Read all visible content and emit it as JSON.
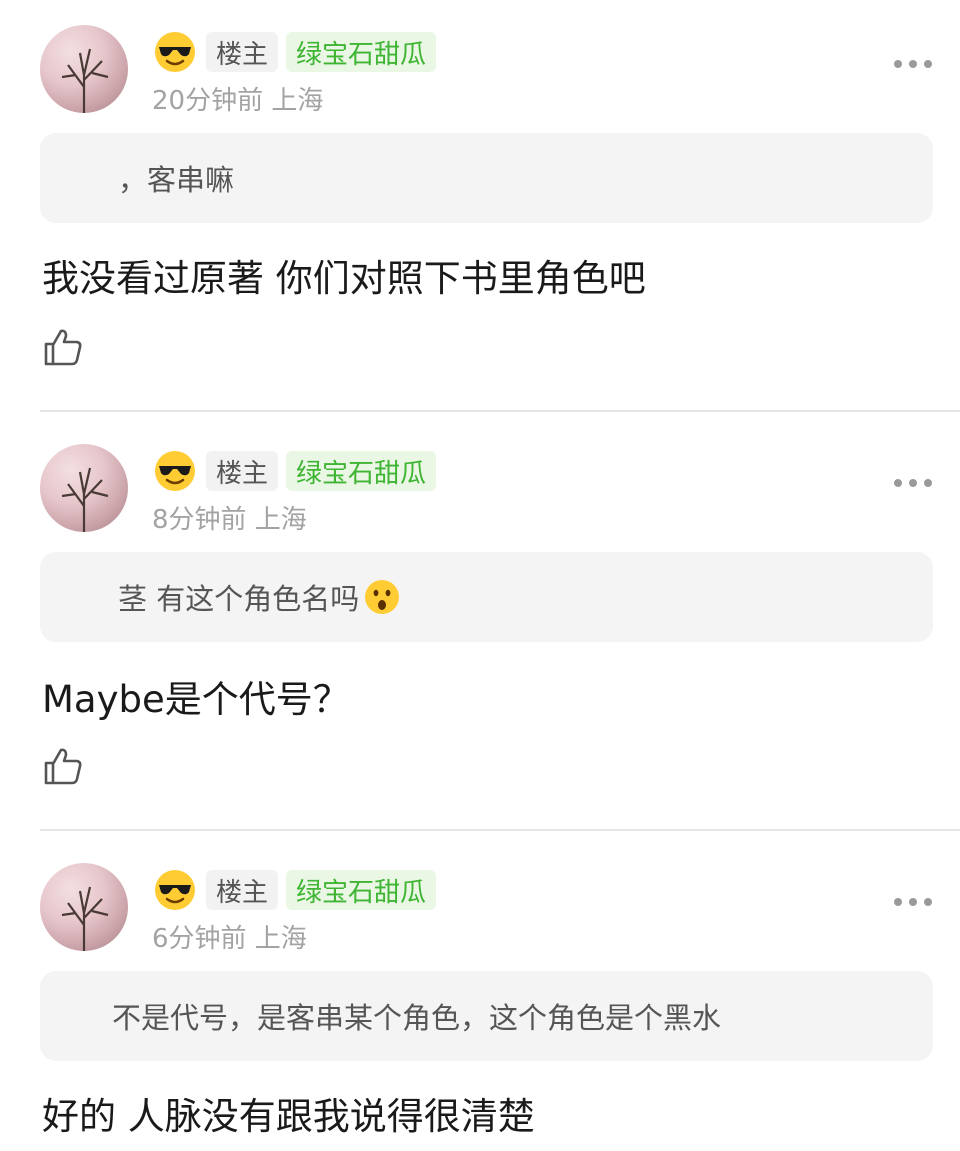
{
  "comments": [
    {
      "badge_op": "楼主",
      "name": "绿宝石甜瓜",
      "meta": "20分钟前 上海",
      "quote": "，客串嘛",
      "text": "我没看过原著 你们对照下书里角色吧"
    },
    {
      "badge_op": "楼主",
      "name": "绿宝石甜瓜",
      "meta": "8分钟前 上海",
      "quote": "茎 有这个角色名吗",
      "text": "Maybe是个代号？"
    },
    {
      "badge_op": "楼主",
      "name": "绿宝石甜瓜",
      "meta": "6分钟前 上海",
      "quote": "不是代号，是客串某个角色，这个角色是个黑水",
      "text": "好的 人脉没有跟我说得很清楚"
    }
  ],
  "icons": {
    "cool": "smiling-face-with-sunglasses",
    "surprised": "face-with-open-mouth",
    "like": "thumbs-up-outline",
    "more": "ellipsis-horizontal"
  },
  "colors": {
    "name_green": "#3fb533",
    "name_bg": "#e9f7e4",
    "meta_gray": "#a3a3a3",
    "quote_bg": "#f4f4f4"
  }
}
